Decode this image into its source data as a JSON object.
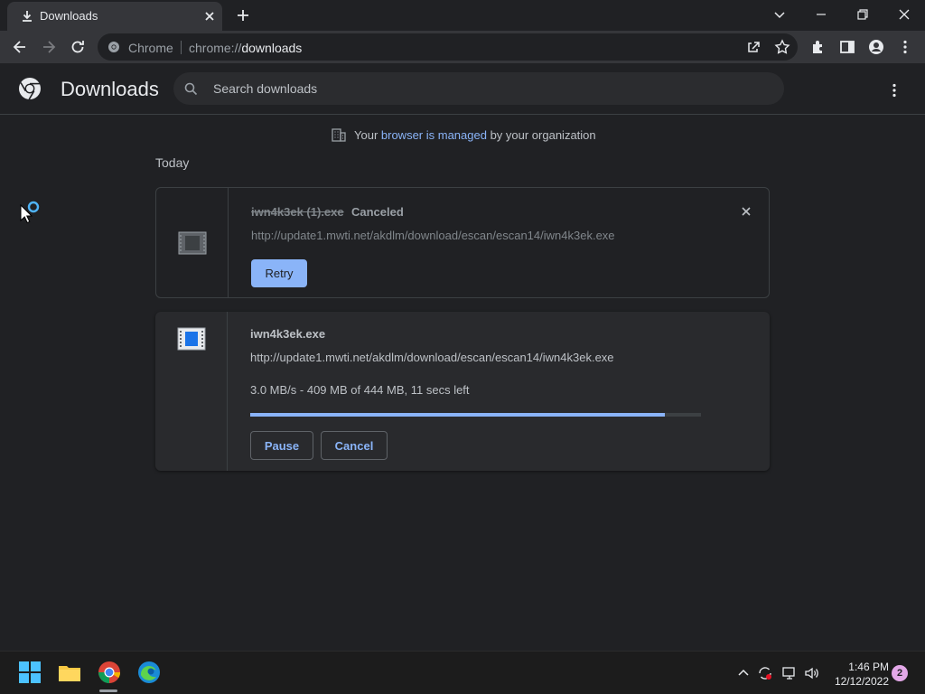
{
  "tab": {
    "title": "Downloads",
    "icon": "download-icon"
  },
  "omnibox": {
    "label": "Chrome",
    "scheme": "chrome://",
    "host": "downloads"
  },
  "header": {
    "title": "Downloads",
    "search_placeholder": "Search downloads"
  },
  "managed": {
    "prefix": "Your ",
    "link": "browser is managed",
    "suffix": " by your organization"
  },
  "section": "Today",
  "downloads": [
    {
      "filename": "iwn4k3ek (1).exe",
      "status": "Canceled",
      "url": "http://update1.mwti.net/akdlm/download/escan/escan14/iwn4k3ek.exe",
      "action": "Retry"
    },
    {
      "filename": "iwn4k3ek.exe",
      "url": "http://update1.mwti.net/akdlm/download/escan/escan14/iwn4k3ek.exe",
      "progress_text": "3.0 MB/s - 409 MB of 444 MB, 11 secs left",
      "progress_fraction": 0.92,
      "pause_label": "Pause",
      "cancel_label": "Cancel"
    }
  ],
  "taskbar": {
    "time": "1:46 PM",
    "date": "12/12/2022",
    "notifications": "2"
  },
  "colors": {
    "accent": "#8ab4f8",
    "background": "#202124",
    "card": "#292a2d"
  }
}
